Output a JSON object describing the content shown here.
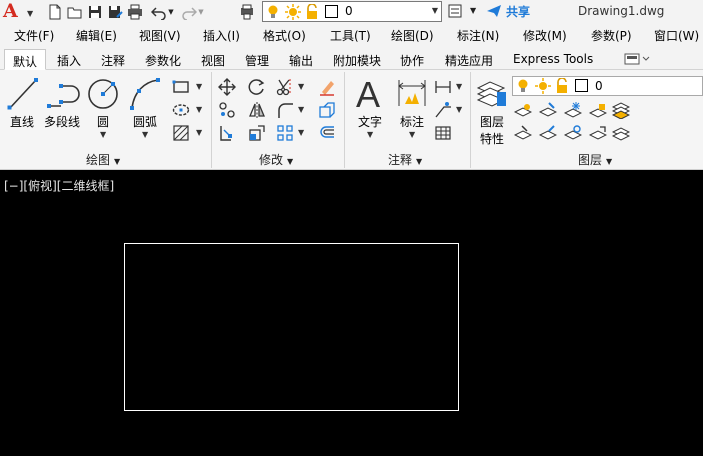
{
  "app": {
    "document_title": "Drawing1.dwg",
    "share_label": "共享"
  },
  "quick_access": {
    "layer_current": "0"
  },
  "menubar": {
    "items": [
      "文件(F)",
      "编辑(E)",
      "视图(V)",
      "插入(I)",
      "格式(O)",
      "工具(T)",
      "绘图(D)",
      "标注(N)",
      "修改(M)",
      "参数(P)",
      "窗口(W)"
    ]
  },
  "ribbon_tabs": {
    "items": [
      "默认",
      "插入",
      "注释",
      "参数化",
      "视图",
      "管理",
      "输出",
      "附加模块",
      "协作",
      "精选应用",
      "Express Tools"
    ],
    "active": "默认"
  },
  "panels": {
    "draw": {
      "label": "绘图",
      "line": "直线",
      "polyline": "多段线",
      "circle": "圆",
      "arc": "圆弧"
    },
    "modify": {
      "label": "修改"
    },
    "annotation": {
      "label": "注释",
      "text": "文字",
      "dimension": "标注"
    },
    "layers": {
      "label": "图层",
      "properties_line1": "图层",
      "properties_line2": "特性",
      "layer_current": "0"
    }
  },
  "viewport": {
    "label": "[−][俯视][二维线框]"
  },
  "colors": {
    "accent": "#1f7bd8",
    "logo": "#d42b20",
    "canvas": "#000000",
    "bulb": "#f4b000"
  }
}
